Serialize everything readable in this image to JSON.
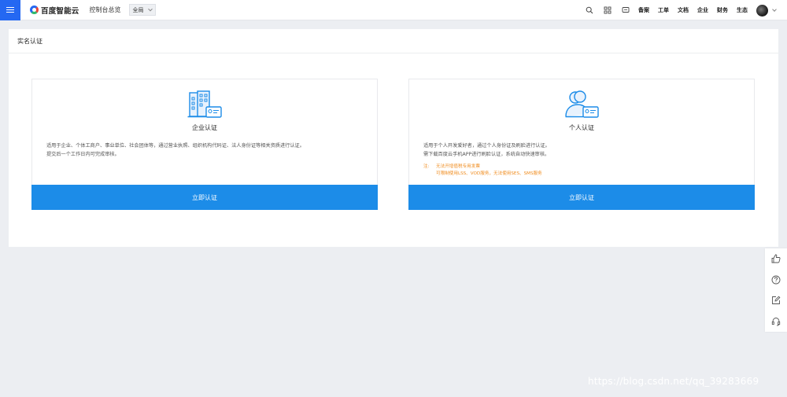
{
  "topbar": {
    "logo_text": "百度智能云",
    "console_link": "控制台总览",
    "region": "全局",
    "nav_links": [
      "备案",
      "工单",
      "文档",
      "企业",
      "财务",
      "生态"
    ]
  },
  "panel": {
    "title": "实名认证"
  },
  "cards": {
    "enterprise": {
      "title": "企业认证",
      "desc_line1": "适用于企业、个体工商户、事业单位、社会团体等，通过营业执照、组织机构代码证、法人身份证等相关资质进行认证。",
      "desc_line2": "提交后一个工作日内可完成审核。",
      "button": "立即认证"
    },
    "personal": {
      "title": "个人认证",
      "desc_line1": "适用于个人开发爱好者，通过个人身份证及刷脸进行认证。",
      "desc_line2": "需下载百度云手机APP进行刷脸认证，系统自动快速审核。",
      "note_label": "注:",
      "note_line1": "无法开增值税专用发票",
      "note_line2": "可限制使用LSS、VOD服务，无法使用SES、SMS服务",
      "button": "立即认证"
    }
  },
  "watermark": "https://blog.csdn.net/qq_39283669",
  "colors": {
    "brand_blue": "#2468f2",
    "button_blue": "#1c8ce8",
    "note_orange": "#f08c1e"
  },
  "icons": [
    "menu-icon",
    "search-icon",
    "grid-icon",
    "message-icon",
    "building-icon",
    "person-id-icon",
    "thumbs-up-icon",
    "help-icon",
    "edit-icon",
    "headset-icon"
  ]
}
